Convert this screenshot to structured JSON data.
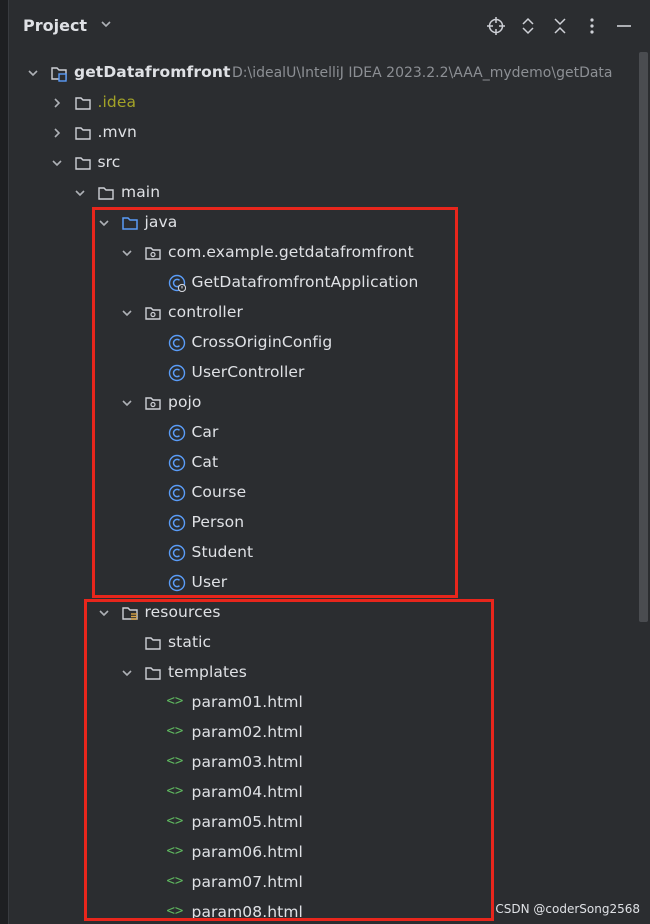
{
  "panel": {
    "title": "Project"
  },
  "header_icons": [
    "crosshair-icon",
    "expand-collapse-icon",
    "collapse-all-icon",
    "kebab-menu-icon",
    "minimize-icon"
  ],
  "tree": [
    {
      "label": "getDatafromfront",
      "path": "D:\\idealU\\IntelliJ IDEA 2023.2.2\\AAA_mydemo\\getData",
      "icon": "module-folder-icon",
      "toggle": "open",
      "level": 0,
      "bold": true
    },
    {
      "label": ".idea",
      "icon": "folder-icon",
      "toggle": "closed",
      "level": 1,
      "idea": true
    },
    {
      "label": ".mvn",
      "icon": "folder-icon",
      "toggle": "closed",
      "level": 1
    },
    {
      "label": "src",
      "icon": "folder-icon",
      "toggle": "open",
      "level": 1
    },
    {
      "label": "main",
      "icon": "folder-icon",
      "toggle": "open",
      "level": 2
    },
    {
      "label": "java",
      "icon": "source-folder-icon",
      "toggle": "open",
      "level": 3
    },
    {
      "label": "com.example.getdatafromfront",
      "icon": "package-icon",
      "toggle": "open",
      "level": 4
    },
    {
      "label": "GetDatafromfrontApplication",
      "icon": "spring-class-icon",
      "toggle": "none",
      "level": 5
    },
    {
      "label": "controller",
      "icon": "package-icon",
      "toggle": "open",
      "level": 4
    },
    {
      "label": "CrossOriginConfig",
      "icon": "class-icon",
      "toggle": "none",
      "level": 5
    },
    {
      "label": "UserController",
      "icon": "class-icon",
      "toggle": "none",
      "level": 5
    },
    {
      "label": "pojo",
      "icon": "package-icon",
      "toggle": "open",
      "level": 4
    },
    {
      "label": "Car",
      "icon": "class-icon",
      "toggle": "none",
      "level": 5
    },
    {
      "label": "Cat",
      "icon": "class-icon",
      "toggle": "none",
      "level": 5
    },
    {
      "label": "Course",
      "icon": "class-icon",
      "toggle": "none",
      "level": 5
    },
    {
      "label": "Person",
      "icon": "class-icon",
      "toggle": "none",
      "level": 5
    },
    {
      "label": "Student",
      "icon": "class-icon",
      "toggle": "none",
      "level": 5
    },
    {
      "label": "User",
      "icon": "class-icon",
      "toggle": "none",
      "level": 5
    },
    {
      "label": "resources",
      "icon": "resources-folder-icon",
      "toggle": "open",
      "level": 3
    },
    {
      "label": "static",
      "icon": "folder-icon",
      "toggle": "none",
      "level": 4
    },
    {
      "label": "templates",
      "icon": "folder-icon",
      "toggle": "open",
      "level": 4
    },
    {
      "label": "param01.html",
      "icon": "html-file-icon",
      "toggle": "none",
      "level": 5
    },
    {
      "label": "param02.html",
      "icon": "html-file-icon",
      "toggle": "none",
      "level": 5
    },
    {
      "label": "param03.html",
      "icon": "html-file-icon",
      "toggle": "none",
      "level": 5
    },
    {
      "label": "param04.html",
      "icon": "html-file-icon",
      "toggle": "none",
      "level": 5
    },
    {
      "label": "param05.html",
      "icon": "html-file-icon",
      "toggle": "none",
      "level": 5
    },
    {
      "label": "param06.html",
      "icon": "html-file-icon",
      "toggle": "none",
      "level": 5
    },
    {
      "label": "param07.html",
      "icon": "html-file-icon",
      "toggle": "none",
      "level": 5
    },
    {
      "label": "param08.html",
      "icon": "html-file-icon",
      "toggle": "none",
      "level": 5
    }
  ],
  "watermark": "CSDN @coderSong2568",
  "colors": {
    "background": "#2b2d30",
    "text": "#dfe1e5",
    "highlight": "#e8261c",
    "class_icon": "#5a9cf8",
    "html_icon": "#5fb85f",
    "idea_text": "#a3a327"
  }
}
